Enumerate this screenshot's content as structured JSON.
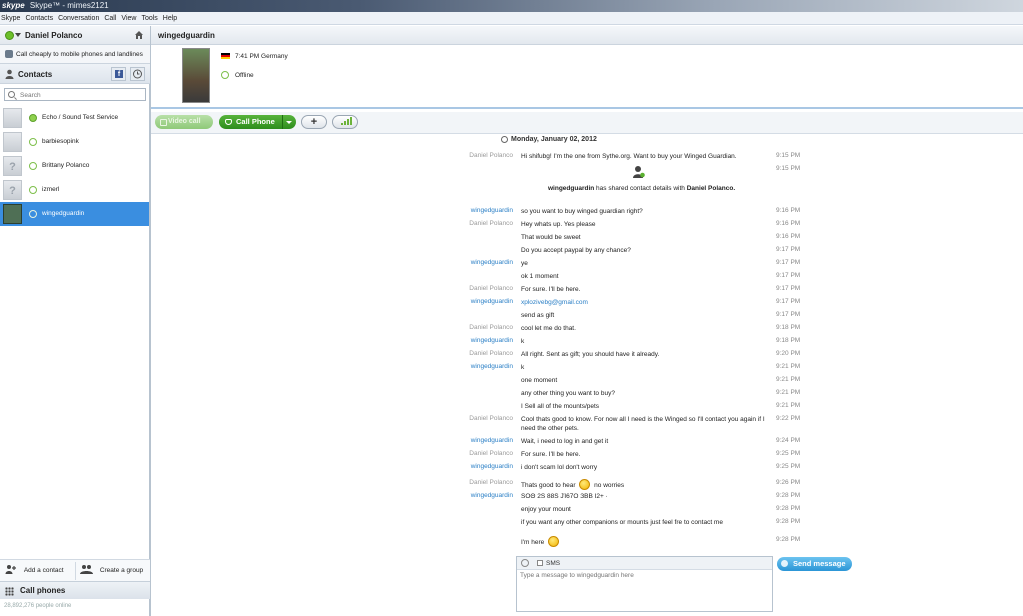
{
  "window": {
    "logo": "skype",
    "title": "Skype™ - mimes2121"
  },
  "menu": [
    "Skype",
    "Contacts",
    "Conversation",
    "Call",
    "View",
    "Tools",
    "Help"
  ],
  "sidebar": {
    "profile_name": "Daniel Polanco",
    "promo_text": "Call cheaply to mobile phones and landlines",
    "contacts_label": "Contacts",
    "search_placeholder": "Search",
    "contacts": [
      {
        "name": "Echo / Sound Test Service",
        "avatar": ""
      },
      {
        "name": "barbiesopink",
        "avatar": ""
      },
      {
        "name": "Brittany Polanco",
        "avatar": "?"
      },
      {
        "name": "izmerl",
        "avatar": "?"
      },
      {
        "name": "wingedguardin",
        "avatar": ""
      }
    ],
    "add_contact": "Add a contact",
    "create_group": "Create a group",
    "call_phones": "Call phones",
    "online_count": "28,892,276 people online"
  },
  "conversation": {
    "contact_name": "wingedguardin",
    "local_time": "7:41 PM Germany",
    "status": "Offline",
    "video_call": "Video call",
    "call_phone": "Call Phone",
    "add_symbol": "+",
    "date_header": "Monday, January 02, 2012",
    "share_actor": "wingedguardin",
    "share_text": " has shared contact details with ",
    "share_target": "Daniel Polanco.",
    "share_time": "9:15 PM",
    "messages": [
      {
        "sender": "Daniel Polanco",
        "who": "me",
        "text": "Hi shifubg! I'm the one from Sythe.org.   Want to buy your Winged Guardian.",
        "time": "9:15 PM"
      },
      {
        "sender": "wingedguardin",
        "who": "them",
        "text": "so you want to buy winged guardian right?",
        "time": "9:16 PM"
      },
      {
        "sender": "Daniel Polanco",
        "who": "me",
        "text": "Hey whats up.  Yes please",
        "time": "9:16 PM"
      },
      {
        "sender": "",
        "who": "me",
        "text": "That would be sweet",
        "time": "9:16 PM"
      },
      {
        "sender": "",
        "who": "me",
        "text": "Do you accept paypal by any chance?",
        "time": "9:17 PM"
      },
      {
        "sender": "wingedguardin",
        "who": "them",
        "text": "ye",
        "time": "9:17 PM"
      },
      {
        "sender": "",
        "who": "them",
        "text": "ok 1 moment",
        "time": "9:17 PM"
      },
      {
        "sender": "Daniel Polanco",
        "who": "me",
        "text": "For sure. I'll be here.",
        "time": "9:17 PM"
      },
      {
        "sender": "wingedguardin",
        "who": "them",
        "text": "xplozivebg@gmail.com",
        "time": "9:17 PM",
        "link": true
      },
      {
        "sender": "",
        "who": "them",
        "text": "send as gift",
        "time": "9:17 PM"
      },
      {
        "sender": "Daniel Polanco",
        "who": "me",
        "text": "cool let me do that.",
        "time": "9:18 PM"
      },
      {
        "sender": "wingedguardin",
        "who": "them",
        "text": "k",
        "time": "9:18 PM"
      },
      {
        "sender": "Daniel Polanco",
        "who": "me",
        "text": "All right. Sent as gift; you should have it already.",
        "time": "9:20 PM"
      },
      {
        "sender": "wingedguardin",
        "who": "them",
        "text": "k",
        "time": "9:21 PM"
      },
      {
        "sender": "",
        "who": "them",
        "text": "one moment",
        "time": "9:21 PM"
      },
      {
        "sender": "",
        "who": "them",
        "text": "any other thing you want to buy?",
        "time": "9:21 PM"
      },
      {
        "sender": "",
        "who": "them",
        "text": "I Sell all of the mounts/pets",
        "time": "9:21 PM"
      },
      {
        "sender": "Daniel Polanco",
        "who": "me",
        "text": "Cool thats good to know. For now all I need is the Winged so I'll contact you again if I need the other pets.",
        "time": "9:22 PM",
        "tall": true
      },
      {
        "sender": "wingedguardin",
        "who": "them",
        "text": "Wait, i need to log in and get it",
        "time": "9:24 PM"
      },
      {
        "sender": "Daniel Polanco",
        "who": "me",
        "text": "For sure. I'll be here.",
        "time": "9:25 PM"
      },
      {
        "sender": "wingedguardin",
        "who": "them",
        "text": "i don't scam lol don't worry",
        "time": "9:25 PM"
      },
      {
        "sender": "Daniel Polanco",
        "who": "me",
        "text": "Thats good to hear ",
        "suffix": " no worries",
        "emoticon": true,
        "time": "9:26 PM"
      },
      {
        "sender": "wingedguardin",
        "who": "them",
        "text": "ЅΟΘ  2Ѕ  88Ѕ  ЈΊ67Ο  ЗΒΒ  Ι2+  ·",
        "time": "9:28 PM"
      },
      {
        "sender": "",
        "who": "them",
        "text": "enjoy your mount",
        "time": "9:28 PM"
      },
      {
        "sender": "",
        "who": "them",
        "text": "if you want any other companions or mounts just feel fre to contact me",
        "time": "9:28 PM"
      },
      {
        "sender": "",
        "who": "me",
        "text": "I'm here ",
        "emoticon": true,
        "time": "9:28 PM"
      }
    ],
    "sms_label": "SMS",
    "compose_placeholder": "Type a message to wingedguardin here",
    "send_label": "Send message"
  },
  "colors": {
    "accent": "#3a8ee0",
    "call_green": "#2d8d1d",
    "link_blue": "#2a7fc6"
  }
}
